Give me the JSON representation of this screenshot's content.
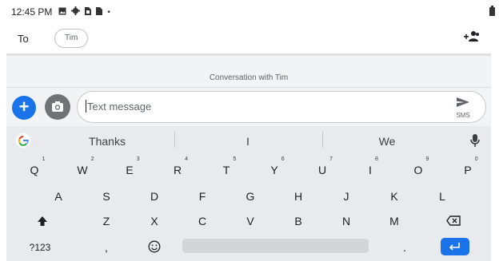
{
  "status_bar": {
    "time": "12:45 PM",
    "dot": "•"
  },
  "compose": {
    "to_label": "To",
    "recipient": "Tim"
  },
  "conversation": {
    "title": "Conversation with Tim"
  },
  "input": {
    "placeholder": "Text message",
    "send_label": "SMS"
  },
  "keyboard": {
    "suggestions": [
      "Thanks",
      "I",
      "We"
    ],
    "row1": [
      {
        "key": "Q",
        "hint": "1"
      },
      {
        "key": "W",
        "hint": "2"
      },
      {
        "key": "E",
        "hint": "3"
      },
      {
        "key": "R",
        "hint": "4"
      },
      {
        "key": "T",
        "hint": "5"
      },
      {
        "key": "Y",
        "hint": "6"
      },
      {
        "key": "U",
        "hint": "7"
      },
      {
        "key": "I",
        "hint": "8"
      },
      {
        "key": "O",
        "hint": "9"
      },
      {
        "key": "P",
        "hint": "0"
      }
    ],
    "row2": [
      "A",
      "S",
      "D",
      "F",
      "G",
      "H",
      "J",
      "K",
      "L"
    ],
    "row3": [
      "Z",
      "X",
      "C",
      "V",
      "B",
      "N",
      "M"
    ],
    "symbols_label": "?123",
    "comma": ",",
    "period": "."
  },
  "colors": {
    "accent": "#1a73e8",
    "keyboard_bg": "#e8eaed",
    "conversation_bg": "#f1f3f4"
  },
  "icons": [
    "image-icon",
    "settings-icon",
    "sim-icon",
    "signal-icon",
    "battery-icon",
    "add-people-icon",
    "plus-icon",
    "camera-icon",
    "send-icon",
    "google-icon",
    "mic-icon",
    "shift-icon",
    "backspace-icon",
    "emoji-icon",
    "enter-icon"
  ]
}
